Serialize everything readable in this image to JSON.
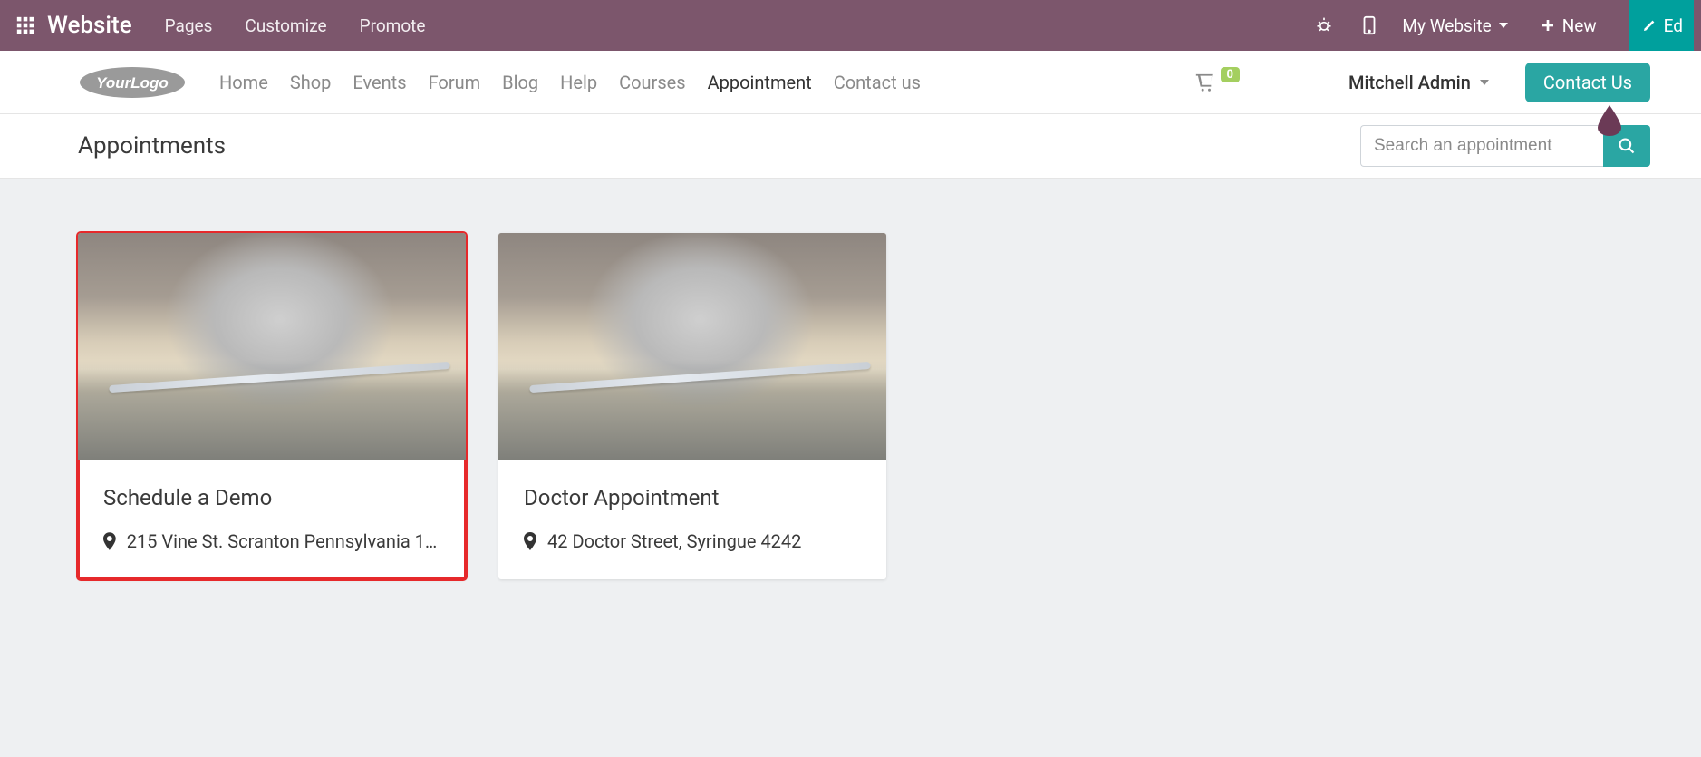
{
  "topbar": {
    "brand": "Website",
    "menu": [
      "Pages",
      "Customize",
      "Promote"
    ],
    "website_switch_label": "My Website",
    "new_label": "New",
    "edit_label": "Ed"
  },
  "sitenav": {
    "links": [
      {
        "label": "Home",
        "active": false
      },
      {
        "label": "Shop",
        "active": false
      },
      {
        "label": "Events",
        "active": false
      },
      {
        "label": "Forum",
        "active": false
      },
      {
        "label": "Blog",
        "active": false
      },
      {
        "label": "Help",
        "active": false
      },
      {
        "label": "Courses",
        "active": false
      },
      {
        "label": "Appointment",
        "active": true
      },
      {
        "label": "Contact us",
        "active": false
      }
    ],
    "cart_count": "0",
    "user_name": "Mitchell Admin",
    "contact_label": "Contact Us"
  },
  "subheader": {
    "title": "Appointments",
    "search_placeholder": "Search an appointment"
  },
  "cards": [
    {
      "title": "Schedule a Demo",
      "address": "215 Vine St. Scranton Pennsylvania 18…",
      "selected": true
    },
    {
      "title": "Doctor Appointment",
      "address": "42 Doctor Street, Syringue 4242",
      "selected": false
    }
  ],
  "colors": {
    "topbar": "#7c566c",
    "teal": "#2aa6a3",
    "edit_teal": "#00a09d",
    "badge_green": "#a4cf5f",
    "select_red": "#e6292b",
    "drop_purple": "#6b3a56"
  }
}
